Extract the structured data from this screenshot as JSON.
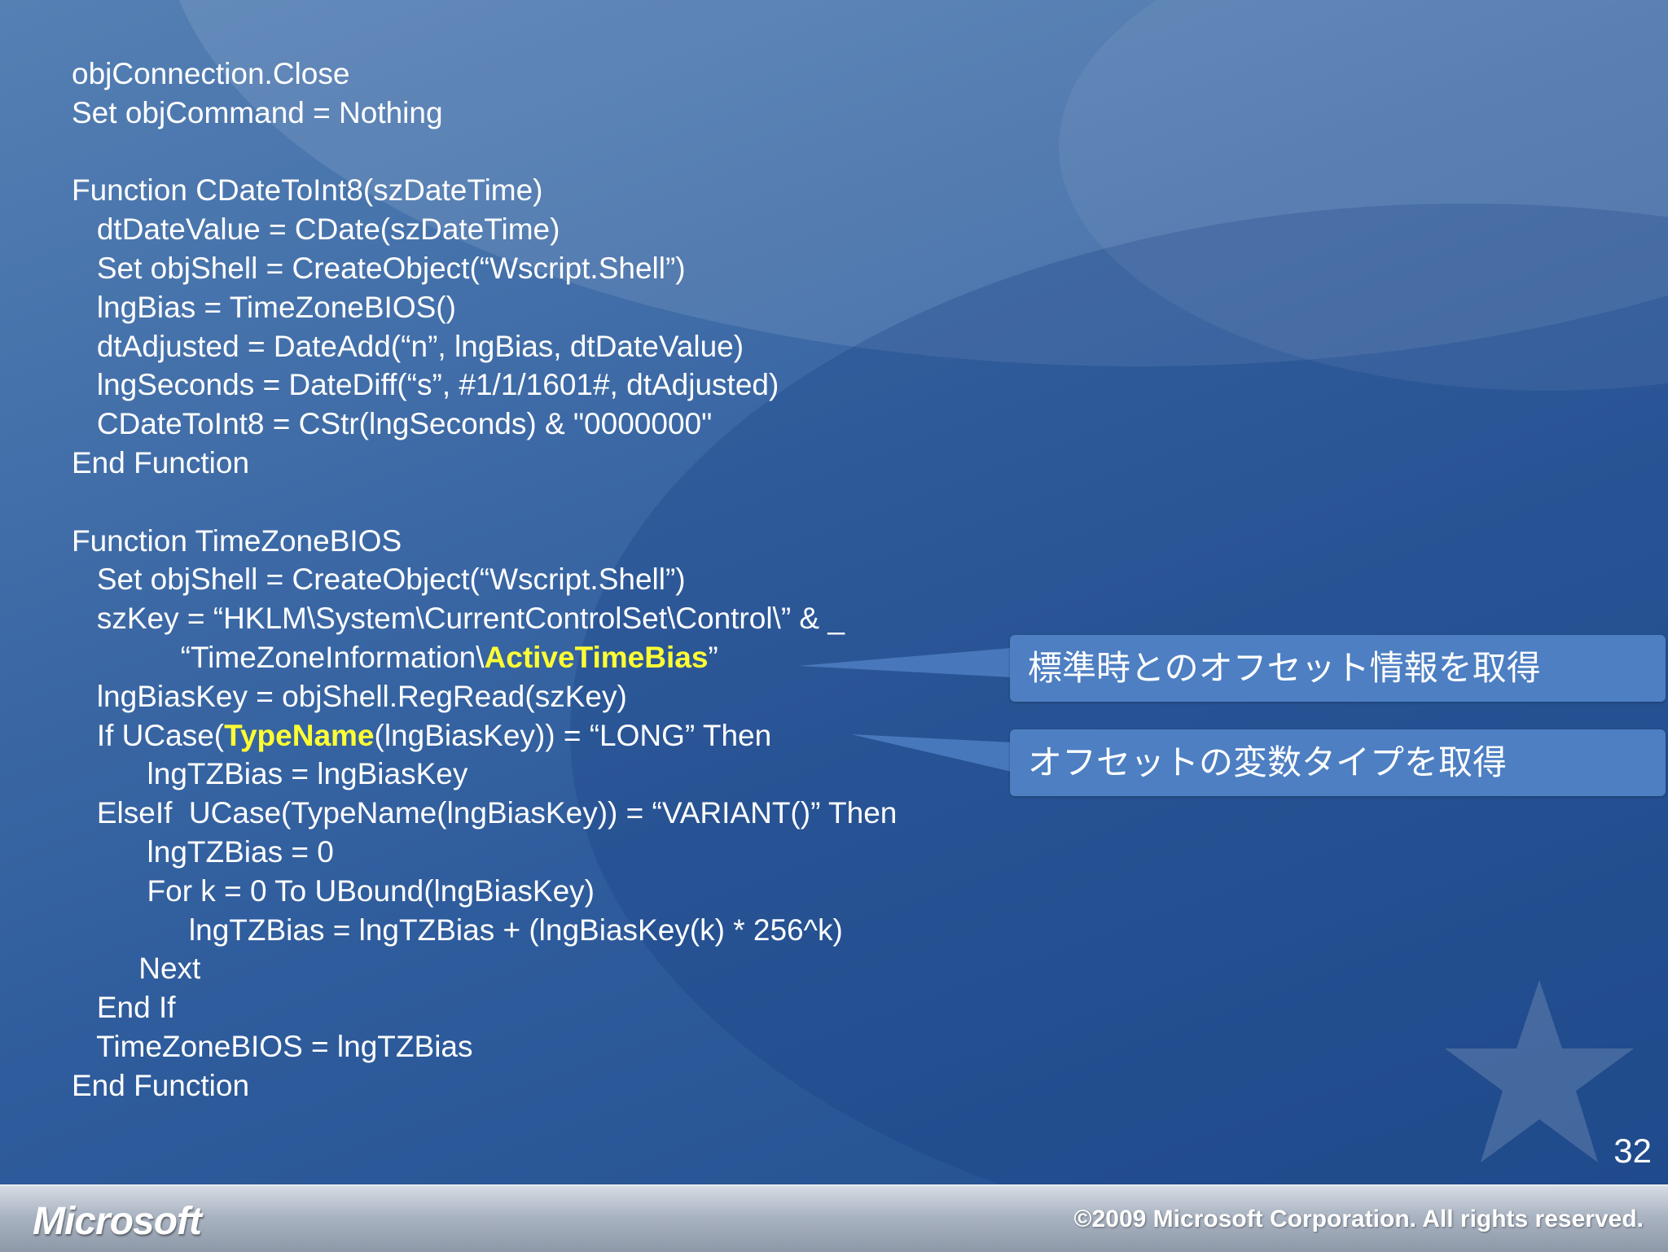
{
  "code_lines": [
    {
      "text": "objConnection.Close"
    },
    {
      "text": "Set objCommand = Nothing"
    },
    {
      "text": ""
    },
    {
      "text": "Function CDateToInt8(szDateTime)"
    },
    {
      "text": "   dtDateValue = CDate(szDateTime)"
    },
    {
      "text": "   Set objShell = CreateObject(“Wscript.Shell”)"
    },
    {
      "text": "   lngBias = TimeZoneBIOS()"
    },
    {
      "text": "   dtAdjusted = DateAdd(“n”, lngBias, dtDateValue)"
    },
    {
      "text": "   lngSeconds = DateDiff(“s”, #1/1/1601#, dtAdjusted)"
    },
    {
      "text": "   CDateToInt8 = CStr(lngSeconds) & \"0000000\""
    },
    {
      "text": "End Function"
    },
    {
      "text": ""
    },
    {
      "text": "Function TimeZoneBIOS"
    },
    {
      "text": "   Set objShell = CreateObject(“Wscript.Shell”)"
    },
    {
      "text": "   szKey = “HKLM\\System\\CurrentControlSet\\Control\\” & _"
    },
    {
      "before": "             “TimeZoneInformation\\",
      "highlight": "ActiveTimeBias",
      "after": "”"
    },
    {
      "text": "   lngBiasKey = objShell.RegRead(szKey)"
    },
    {
      "before": "   If UCase(",
      "highlight": "TypeName",
      "after": "(lngBiasKey)) = “LONG” Then"
    },
    {
      "text": "         lngTZBias = lngBiasKey"
    },
    {
      "text": "   ElseIf  UCase(TypeName(lngBiasKey)) = “VARIANT()” Then"
    },
    {
      "text": "         lngTZBias = 0"
    },
    {
      "text": "         For k = 0 To UBound(lngBiasKey)"
    },
    {
      "text": "              lngTZBias = lngTZBias + (lngBiasKey(k) * 256^k)"
    },
    {
      "text": "        Next"
    },
    {
      "text": "   End If"
    },
    {
      "text": "   TimeZoneBIOS = lngTZBias"
    },
    {
      "text": "End Function"
    }
  ],
  "callouts": {
    "offset_info": "標準時とのオフセット情報を取得",
    "variable_type": "オフセットの変数タイプを取得"
  },
  "slide_number": "32",
  "footer": {
    "logo": "Microsoft",
    "copyright": "©2009 Microsoft Corporation. All rights reserved."
  },
  "colors": {
    "background": "#2f5c9c",
    "code_text": "#ffffff",
    "highlight": "#ffff33",
    "callout_fill": "#4d7fc2"
  }
}
